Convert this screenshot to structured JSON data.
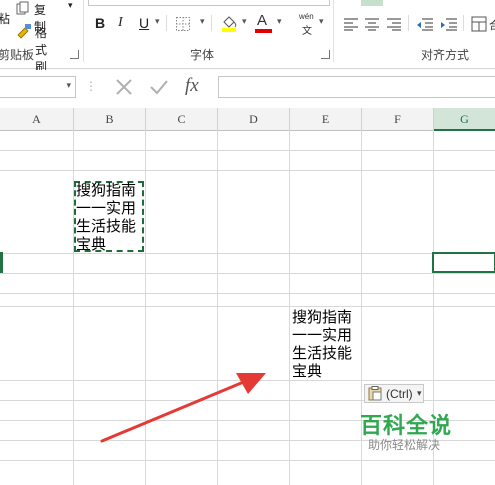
{
  "ribbon": {
    "paste_partial": "粘",
    "copy_label": "复制",
    "format_painter_label": "格式刷",
    "clipboard_group": "剪贴板",
    "font_group": "字体",
    "align_group": "对齐方式",
    "bold": "B",
    "italic": "I",
    "underline": "U",
    "font_color_letter": "A",
    "phonetic_top": "wén",
    "phonetic_bottom": "文",
    "fx": "fx"
  },
  "columns": [
    "A",
    "B",
    "C",
    "D",
    "E",
    "F",
    "G"
  ],
  "cells": {
    "b_content": "搜狗指南一一实用生活技能宝典",
    "e_content": "搜狗指南一一实用生活技能宝典"
  },
  "paste_options": {
    "label": "(Ctrl)"
  },
  "watermark": {
    "title": "百科全说",
    "subtitle": "助你轻松解决"
  },
  "colors": {
    "excel_green": "#217346",
    "arrow_red": "#e53935",
    "marquee": "#1e6b3c"
  }
}
